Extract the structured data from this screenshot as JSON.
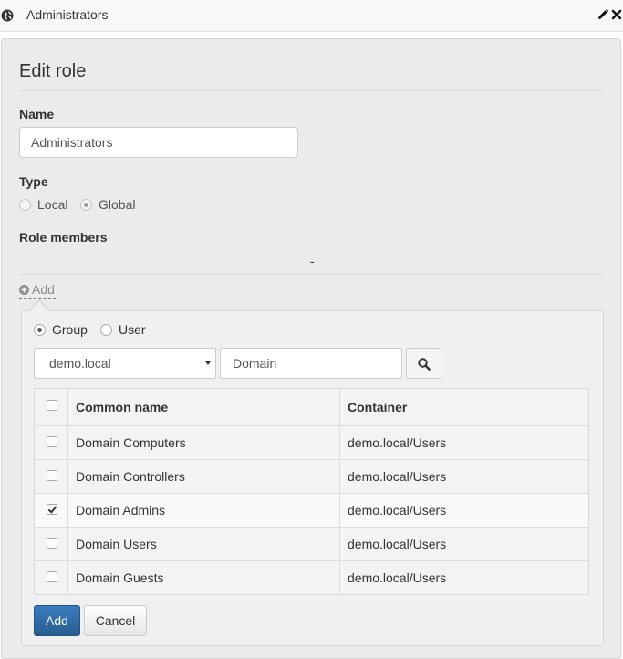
{
  "window": {
    "title": "Administrators",
    "icons": [
      "globe-icon",
      "pencil-icon",
      "close-icon"
    ]
  },
  "form": {
    "heading": "Edit role",
    "name_label": "Name",
    "name_value": "Administrators",
    "type_label": "Type",
    "type_options": [
      {
        "label": "Local",
        "selected": false
      },
      {
        "label": "Global",
        "selected": true
      }
    ],
    "members_label": "Role members",
    "members_placeholder": "-",
    "add_link": "Add"
  },
  "picker": {
    "kind_options": [
      {
        "label": "Group",
        "selected": true
      },
      {
        "label": "User",
        "selected": false
      }
    ],
    "domain_select": "demo.local",
    "search_value": "Domain",
    "table": {
      "columns": [
        "Common name",
        "Container"
      ],
      "rows": [
        {
          "name": "Domain Computers",
          "container": "demo.local/Users",
          "checked": false
        },
        {
          "name": "Domain Controllers",
          "container": "demo.local/Users",
          "checked": false
        },
        {
          "name": "Domain Admins",
          "container": "demo.local/Users",
          "checked": true
        },
        {
          "name": "Domain Users",
          "container": "demo.local/Users",
          "checked": false
        },
        {
          "name": "Domain Guests",
          "container": "demo.local/Users",
          "checked": false
        }
      ]
    },
    "add_button": "Add",
    "cancel_button": "Cancel"
  },
  "colors": {
    "primary": "#2e6da4",
    "panel_bg": "#ebebeb",
    "popup_bg": "#f0f0f0"
  }
}
